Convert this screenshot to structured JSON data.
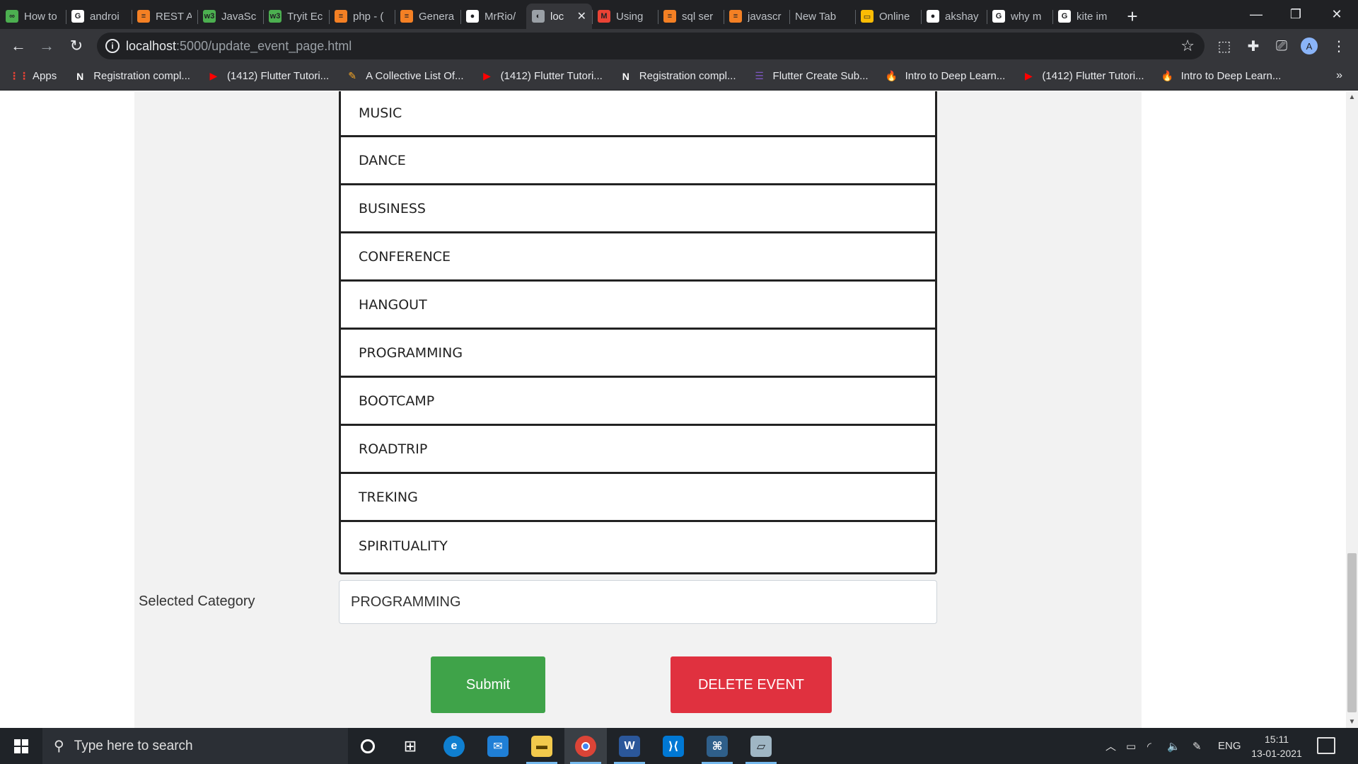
{
  "browser": {
    "tabs": [
      {
        "label": "How to",
        "icon": "ai-icon",
        "color": "#4caf50",
        "glyph": "∞"
      },
      {
        "label": "androi",
        "icon": "google-icon",
        "color": "#ffffff",
        "glyph": "G"
      },
      {
        "label": "REST A",
        "icon": "stackoverflow-icon",
        "color": "#f48024",
        "glyph": "≡"
      },
      {
        "label": "JavaSc",
        "icon": "w3schools-icon",
        "color": "#4caf50",
        "glyph": "w3"
      },
      {
        "label": "Tryit Ec",
        "icon": "w3schools-icon",
        "color": "#4caf50",
        "glyph": "w3"
      },
      {
        "label": "php - (",
        "icon": "stackoverflow-icon",
        "color": "#f48024",
        "glyph": "≡"
      },
      {
        "label": "Genera",
        "icon": "stackoverflow-icon",
        "color": "#f48024",
        "glyph": "≡"
      },
      {
        "label": "MrRio/",
        "icon": "github-icon",
        "color": "#ffffff",
        "glyph": "●"
      },
      {
        "label": "loc",
        "icon": "globe-icon",
        "color": "#9aa0a6",
        "glyph": "◐",
        "active": true
      },
      {
        "label": "Using",
        "icon": "gmail-icon",
        "color": "#ea4335",
        "glyph": "M"
      },
      {
        "label": "sql ser",
        "icon": "stackoverflow-icon",
        "color": "#f48024",
        "glyph": "≡"
      },
      {
        "label": "javascr",
        "icon": "stackoverflow-icon",
        "color": "#f48024",
        "glyph": "≡"
      },
      {
        "label": "New Tab",
        "icon": "",
        "color": "",
        "glyph": ""
      },
      {
        "label": "Online",
        "icon": "slides-icon",
        "color": "#fbbc04",
        "glyph": "▭"
      },
      {
        "label": "akshay",
        "icon": "github-icon",
        "color": "#ffffff",
        "glyph": "●"
      },
      {
        "label": "why m",
        "icon": "google-icon",
        "color": "#ffffff",
        "glyph": "G"
      },
      {
        "label": "kite im",
        "icon": "google-icon",
        "color": "#ffffff",
        "glyph": "G"
      }
    ],
    "url_host": "localhost",
    "url_path": ":5000/update_event_page.html",
    "bookmarks": [
      {
        "label": "Apps",
        "icon": "apps-grid-icon",
        "color": "#ea4335",
        "glyph": "⋮⋮"
      },
      {
        "label": "Registration compl...",
        "icon": "notion-icon",
        "color": "#ffffff",
        "glyph": "N"
      },
      {
        "label": "(1412) Flutter Tutori...",
        "icon": "youtube-icon",
        "color": "#ff0000",
        "glyph": "▶"
      },
      {
        "label": "A Collective List Of...",
        "icon": "bolt-icon",
        "color": "#f9a825",
        "glyph": "✎"
      },
      {
        "label": "(1412) Flutter Tutori...",
        "icon": "youtube-icon",
        "color": "#ff0000",
        "glyph": "▶"
      },
      {
        "label": "Registration compl...",
        "icon": "notion-icon",
        "color": "#ffffff",
        "glyph": "N"
      },
      {
        "label": "Flutter Create Sub...",
        "icon": "forms-icon",
        "color": "#7e57c2",
        "glyph": "☰"
      },
      {
        "label": "Intro to Deep Learn...",
        "icon": "flame-icon",
        "color": "#ffb300",
        "glyph": "🔥"
      },
      {
        "label": "(1412) Flutter Tutori...",
        "icon": "youtube-icon",
        "color": "#ff0000",
        "glyph": "▶"
      },
      {
        "label": "Intro to Deep Learn...",
        "icon": "flame-icon",
        "color": "#ffb300",
        "glyph": "🔥"
      }
    ],
    "bookmarks_more": "»",
    "avatar_letter": "A"
  },
  "page": {
    "categories": [
      "MUSIC",
      "DANCE",
      "BUSINESS",
      "CONFERENCE",
      "HANGOUT",
      "PROGRAMMING",
      "BOOTCAMP",
      "ROADTRIP",
      "TREKING",
      "SPIRITUALITY"
    ],
    "selected_label": "Selected Category",
    "selected_value": "PROGRAMMING",
    "submit_label": "Submit",
    "delete_label": "DELETE EVENT",
    "colors": {
      "submit": "#3fa349",
      "delete": "#e0313f"
    }
  },
  "taskbar": {
    "search_placeholder": "Type here to search",
    "language": "ENG",
    "time": "15:11",
    "date": "13-01-2021"
  }
}
